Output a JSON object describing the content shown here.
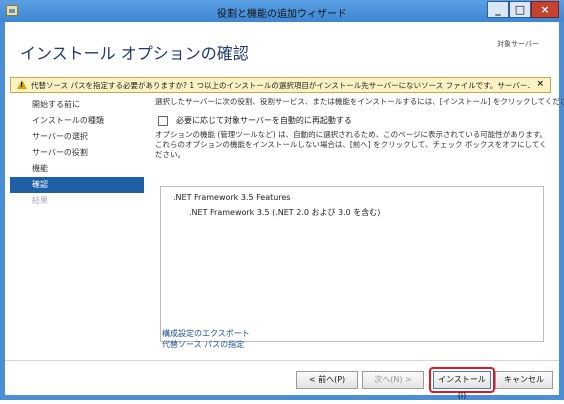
{
  "window": {
    "title": "役割と機能の追加ウィザード",
    "minimize": "_",
    "maximize": "□",
    "close": "×"
  },
  "header": {
    "page_title": "インストール オプションの確認",
    "destination_label": "対象サーバー"
  },
  "warning": {
    "text": "代替ソース パスを指定する必要がありますか? 1 つ以上のインストールの選択項目がインストール先サーバーにないソース ファイルです。サーバー…",
    "close": "×"
  },
  "sidebar": {
    "items": [
      {
        "label": "開始する前に",
        "state": "normal"
      },
      {
        "label": "インストールの種類",
        "state": "normal"
      },
      {
        "label": "サーバーの選択",
        "state": "normal"
      },
      {
        "label": "サーバーの役割",
        "state": "normal"
      },
      {
        "label": "機能",
        "state": "normal"
      },
      {
        "label": "確認",
        "state": "active"
      },
      {
        "label": "結果",
        "state": "disabled"
      }
    ]
  },
  "main": {
    "intro": "選択したサーバーに次の役割、役割サービス、または機能をインストールするには、[インストール] をクリックしてください。",
    "restart_label": "必要に応じて対象サーバーを自動的に再起動する",
    "note": "オプションの機能 (管理ツールなど) は、自動的に選択されるため、このページに表示されている可能性があります。これらのオプションの機能をインストールしない場合は、[前へ] をクリックして、チェック ボックスをオフにしてください。",
    "features": [
      ".NET Framework 3.5 Features",
      ".NET Framework 3.5 (.NET 2.0 および 3.0 を含む)"
    ],
    "export_link": "構成設定のエクスポート",
    "alt_source_link": "代替ソース パスの指定"
  },
  "footer": {
    "prev": "< 前へ(P)",
    "next": "次へ(N) >",
    "install": "インストール(I)",
    "cancel": "キャンセル"
  },
  "colors": {
    "accent": "#1e5fa6",
    "highlight": "#e3171e",
    "warning_bg": "#fbf3c4"
  }
}
